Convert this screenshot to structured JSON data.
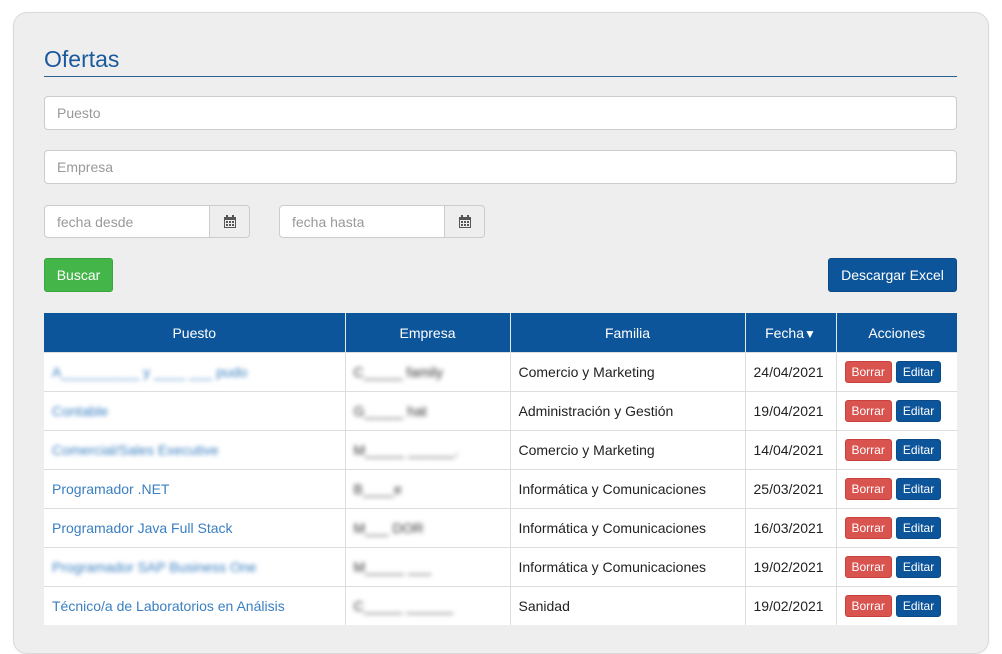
{
  "page": {
    "title": "Ofertas"
  },
  "filters": {
    "puesto_placeholder": "Puesto",
    "empresa_placeholder": "Empresa",
    "fecha_desde_placeholder": "fecha desde",
    "fecha_hasta_placeholder": "fecha hasta"
  },
  "buttons": {
    "buscar": "Buscar",
    "excel": "Descargar Excel"
  },
  "table": {
    "headers": {
      "puesto": "Puesto",
      "empresa": "Empresa",
      "familia": "Familia",
      "fecha": "Fecha",
      "fecha_sort": "▼",
      "acciones": "Acciones"
    },
    "action_labels": {
      "borrar": "Borrar",
      "editar": "Editar"
    },
    "rows": [
      {
        "puesto": "A__________ y ____ ___ pudo",
        "empresa": "C_____ family",
        "familia": "Comercio y Marketing",
        "fecha": "24/04/2021"
      },
      {
        "puesto": "Contable",
        "empresa": "G_____ hat",
        "familia": "Administración y Gestión",
        "fecha": "19/04/2021"
      },
      {
        "puesto": "Comercial/Sales Executive",
        "empresa": "M_____ ______.",
        "familia": "Comercio y Marketing",
        "fecha": "14/04/2021"
      },
      {
        "puesto": "Programador .NET",
        "empresa": "B____e",
        "familia": "Informática y Comunicaciones",
        "fecha": "25/03/2021"
      },
      {
        "puesto": "Programador Java Full Stack",
        "empresa": "M___ DOR",
        "familia": "Informática y Comunicaciones",
        "fecha": "16/03/2021"
      },
      {
        "puesto": "Programador SAP Business One",
        "empresa": "M_____ ___",
        "familia": "Informática y Comunicaciones",
        "fecha": "19/02/2021"
      },
      {
        "puesto": "Técnico/a de Laboratorios en Análisis",
        "empresa": "C_____ ______",
        "familia": "Sanidad",
        "fecha": "19/02/2021"
      }
    ]
  },
  "colors": {
    "primary": "#0d559a",
    "success": "#44b549",
    "danger": "#d9534f",
    "link": "#3a7fc1",
    "title": "#1a5a9c"
  },
  "icons": {
    "calendar": "calendar-icon"
  }
}
